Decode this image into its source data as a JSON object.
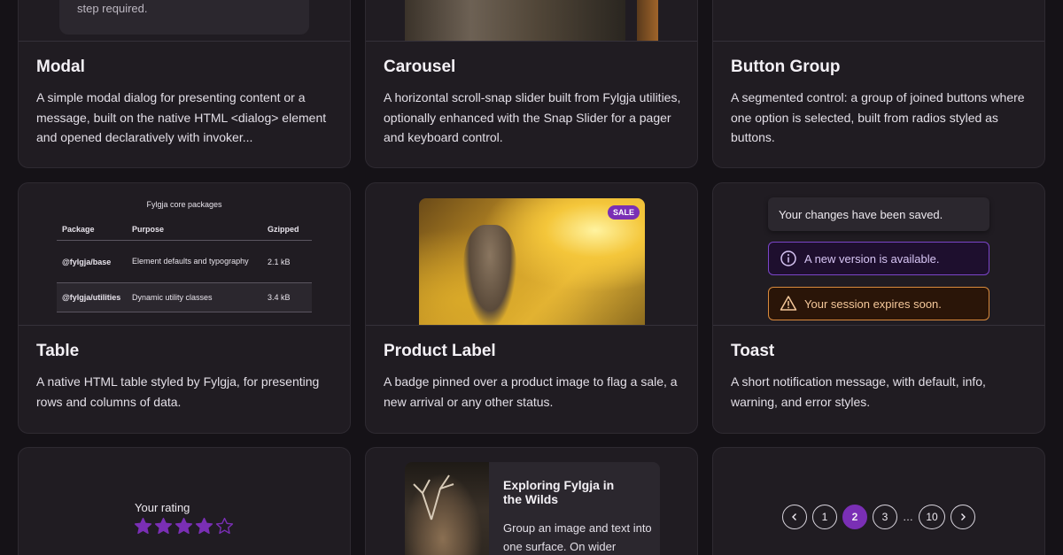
{
  "cards": {
    "modal": {
      "title": "Modal",
      "desc": "A simple modal dialog for presenting content or a message, built on the native HTML <dialog> element and opened declaratively with invoker...",
      "preview_note": "step required."
    },
    "carousel": {
      "title": "Carousel",
      "desc": "A horizontal scroll-snap slider built from Fylgja utilities, optionally enhanced with the Snap Slider for a pager and keyboard control."
    },
    "button_group": {
      "title": "Button Group",
      "desc": "A segmented control: a group of joined buttons where one option is selected, built from radios styled as buttons."
    },
    "table": {
      "title": "Table",
      "desc": "A native HTML table styled by Fylgja, for presenting rows and columns of data.",
      "caption": "Fylgja core packages",
      "headers": [
        "Package",
        "Purpose",
        "Gzipped"
      ],
      "rows": [
        [
          "@fylgja/base",
          "Element defaults and typography",
          "2.1 kB"
        ],
        [
          "@fylgja/utilities",
          "Dynamic utility classes",
          "3.4 kB"
        ]
      ]
    },
    "product_label": {
      "title": "Product Label",
      "desc": "A badge pinned over a product image to flag a sale, a new arrival or any other status.",
      "badge": "SALE"
    },
    "toast": {
      "title": "Toast",
      "desc": "A short notification message, with default, info, warning, and error styles.",
      "default_msg": "Your changes have been saved.",
      "info_msg": "A new version is available.",
      "warning_msg": "Your session expires soon."
    },
    "rating": {
      "label": "Your rating",
      "value": 4,
      "max": 5
    },
    "media_card": {
      "title": "Exploring Fylgja in the Wilds",
      "text": "Group an image and text into one surface. On wider"
    },
    "pagination": {
      "prev": "‹",
      "pages": [
        "1",
        "2",
        "3"
      ],
      "ellipsis": "…",
      "last": "10",
      "next": "›",
      "current": "2"
    }
  },
  "colors": {
    "accent": "#7a2fb5",
    "info_border": "#7b45c9",
    "warning_border": "#d98a3c",
    "page_bg": "#151217",
    "card_bg": "#201c22"
  },
  "icons": [
    "info-icon",
    "warning-icon",
    "star-icon",
    "chevron-left-icon",
    "chevron-right-icon"
  ]
}
